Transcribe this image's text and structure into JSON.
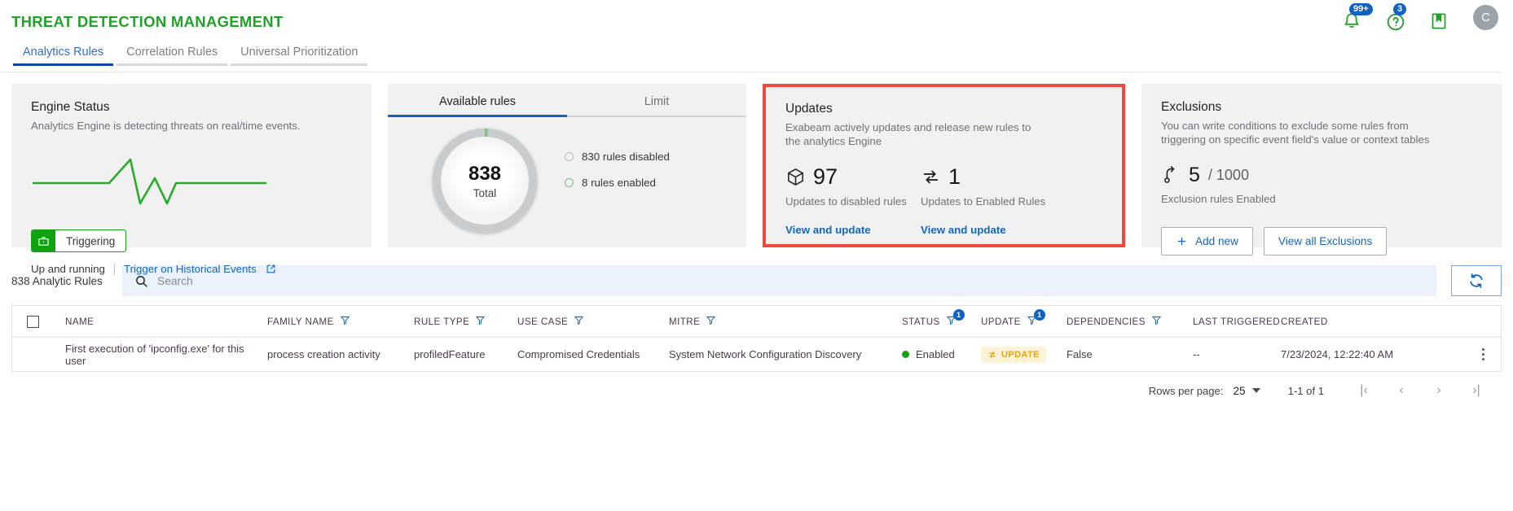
{
  "header": {
    "title": "THREAT DETECTION MANAGEMENT",
    "icons": {
      "notifications": {
        "name": "bell-icon",
        "badge": "99+"
      },
      "help": {
        "name": "help-circle-icon",
        "badge": "3"
      },
      "bookmark": {
        "name": "bookmark-icon"
      },
      "avatar": {
        "initial": "C"
      }
    }
  },
  "tabs": [
    {
      "label": "Analytics Rules",
      "active": true
    },
    {
      "label": "Correlation Rules",
      "active": false
    },
    {
      "label": "Universal Prioritization",
      "active": false
    }
  ],
  "engine_card": {
    "title": "Engine Status",
    "subtitle": "Analytics Engine is detecting threats on real/time events.",
    "status_button": "Triggering",
    "status_text": "Up and running",
    "historical_link": "Trigger on Historical Events"
  },
  "rules_card": {
    "tabs": [
      {
        "label": "Available rules",
        "active": true
      },
      {
        "label": "Limit",
        "active": false
      }
    ],
    "total": "838",
    "total_label": "Total",
    "legend": [
      {
        "label": "830 rules disabled",
        "color": "#b9bcbf"
      },
      {
        "label": "8 rules enabled",
        "color": "#77c077"
      }
    ]
  },
  "updates_card": {
    "title": "Updates",
    "subtitle": "Exabeam actively updates and release new rules to the analytics Engine",
    "highlighted": true,
    "highlight_color": "#f0483e",
    "items": [
      {
        "icon": "cube-icon",
        "value": "97",
        "caption": "Updates to disabled rules",
        "link": "View and update"
      },
      {
        "icon": "sync-icon",
        "value": "1",
        "caption": "Updates to Enabled Rules",
        "link": "View and update"
      }
    ]
  },
  "exclusions_card": {
    "title": "Exclusions",
    "subtitle": "You can write conditions to exclude some rules from triggering on specific event field's value or context tables",
    "value": "5",
    "total": "/ 1000",
    "caption": "Exclusion rules Enabled",
    "add_button": "Add new",
    "view_button": "View all Exclusions"
  },
  "search": {
    "count_label": "838 Analytic Rules",
    "placeholder": "Search",
    "value": "",
    "refresh_icon": "refresh-icon"
  },
  "table": {
    "columns": [
      {
        "label": "NAME",
        "filter": false,
        "filter_count": null
      },
      {
        "label": "FAMILY NAME",
        "filter": true,
        "filter_count": null
      },
      {
        "label": "RULE TYPE",
        "filter": true,
        "filter_count": null
      },
      {
        "label": "USE CASE",
        "filter": true,
        "filter_count": null
      },
      {
        "label": "MITRE",
        "filter": true,
        "filter_count": null
      },
      {
        "label": "STATUS",
        "filter": true,
        "filter_count": "1"
      },
      {
        "label": "UPDATE",
        "filter": true,
        "filter_count": "1"
      },
      {
        "label": "DEPENDENCIES",
        "filter": true,
        "filter_count": null
      },
      {
        "label": "LAST TRIGGERED",
        "filter": false,
        "filter_count": null
      },
      {
        "label": "CREATED",
        "filter": false,
        "filter_count": null
      }
    ],
    "rows": [
      {
        "name": "First execution of 'ipconfig.exe' for this user",
        "family_name": "process creation activity",
        "rule_type": "profiledFeature",
        "use_case": "Compromised Credentials",
        "mitre": "System Network Configuration Discovery",
        "status": "Enabled",
        "update": "UPDATE",
        "dependencies": "False",
        "last_triggered": "--",
        "created": "7/23/2024, 12:22:40 AM"
      }
    ]
  },
  "pagination": {
    "rows_label": "Rows per page:",
    "rows_value": "25",
    "range": "1-1 of 1",
    "first": "|‹",
    "prev": "‹",
    "next": "›",
    "last": "›|"
  }
}
